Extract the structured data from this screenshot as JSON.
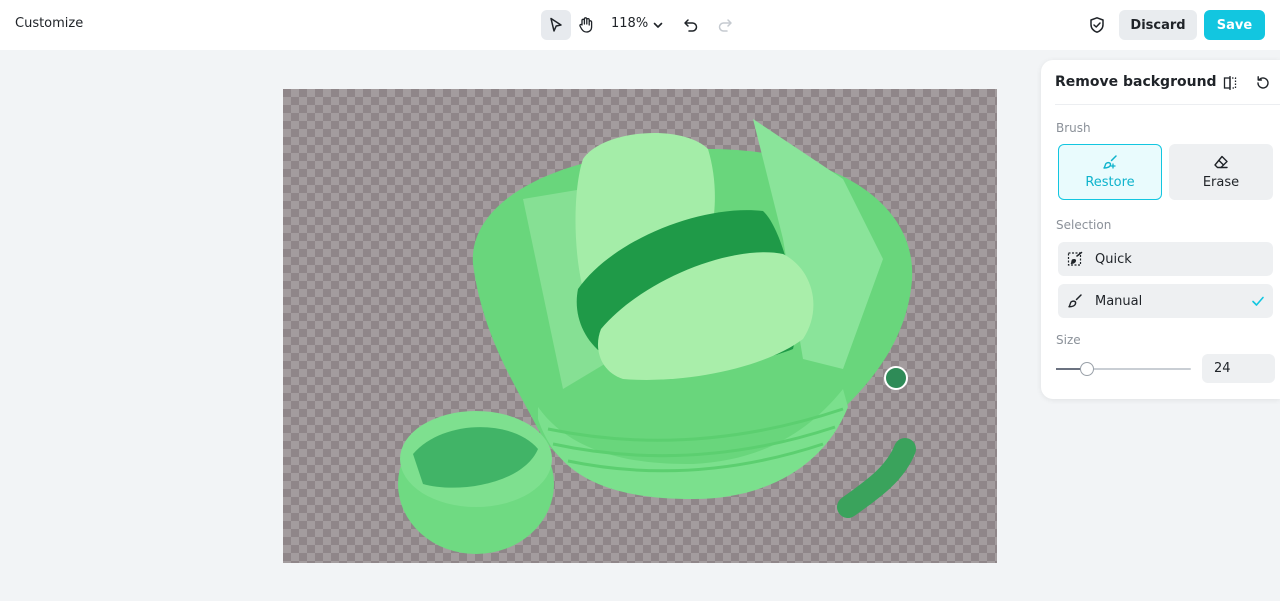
{
  "header": {
    "title": "Customize",
    "zoom": "118%",
    "discard_label": "Discard",
    "save_label": "Save",
    "icons": [
      "pointer-icon",
      "hand-icon",
      "chevron-down-icon",
      "undo-icon",
      "redo-icon",
      "shield-icon"
    ]
  },
  "panel": {
    "title": "Remove background",
    "icons": [
      "compare-icon",
      "reset-icon"
    ],
    "brush": {
      "label": "Brush",
      "restore_label": "Restore",
      "erase_label": "Erase",
      "active": "Restore"
    },
    "selection": {
      "label": "Selection",
      "options": [
        "Quick",
        "Manual"
      ],
      "selected": "Manual"
    },
    "size": {
      "label": "Size",
      "value": "24",
      "slider_fraction": 0.23
    }
  },
  "colors": {
    "accent": "#12c6e0",
    "restore_overlay": "#5fdc74",
    "canvas_bg": "#f2f4f6",
    "brush_cursor": "#2e8b57"
  }
}
